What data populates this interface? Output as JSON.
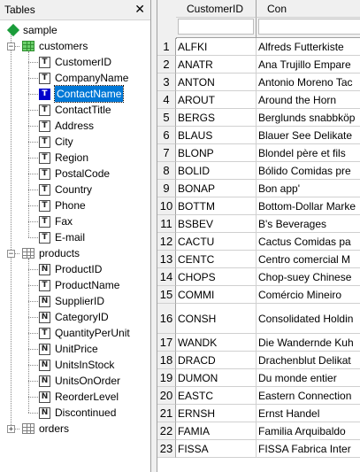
{
  "tables_pane": {
    "title": "Tables",
    "close_label": "✕",
    "database": "sample",
    "tables": [
      {
        "name": "customers",
        "expanded": true,
        "active": true,
        "fields": [
          {
            "name": "CustomerID",
            "type_glyph": "T"
          },
          {
            "name": "CompanyName",
            "type_glyph": "T"
          },
          {
            "name": "ContactName",
            "type_glyph": "T",
            "selected": true
          },
          {
            "name": "ContactTitle",
            "type_glyph": "T"
          },
          {
            "name": "Address",
            "type_glyph": "T"
          },
          {
            "name": "City",
            "type_glyph": "T"
          },
          {
            "name": "Region",
            "type_glyph": "T"
          },
          {
            "name": "PostalCode",
            "type_glyph": "T"
          },
          {
            "name": "Country",
            "type_glyph": "T"
          },
          {
            "name": "Phone",
            "type_glyph": "T"
          },
          {
            "name": "Fax",
            "type_glyph": "T"
          },
          {
            "name": "E-mail",
            "type_glyph": "T"
          }
        ]
      },
      {
        "name": "products",
        "expanded": true,
        "active": false,
        "fields": [
          {
            "name": "ProductID",
            "type_glyph": "N"
          },
          {
            "name": "ProductName",
            "type_glyph": "T"
          },
          {
            "name": "SupplierID",
            "type_glyph": "N"
          },
          {
            "name": "CategoryID",
            "type_glyph": "N"
          },
          {
            "name": "QuantityPerUnit",
            "type_glyph": "T"
          },
          {
            "name": "UnitPrice",
            "type_glyph": "N"
          },
          {
            "name": "UnitsInStock",
            "type_glyph": "N"
          },
          {
            "name": "UnitsOnOrder",
            "type_glyph": "N"
          },
          {
            "name": "ReorderLevel",
            "type_glyph": "N"
          },
          {
            "name": "Discontinued",
            "type_glyph": "N"
          }
        ]
      },
      {
        "name": "orders",
        "expanded": false,
        "active": false,
        "fields": []
      }
    ]
  },
  "grid": {
    "columns": [
      "CustomerID",
      "Con"
    ],
    "rows": [
      {
        "num": "1",
        "id": "ALFKI",
        "name": "Alfreds Futterkiste"
      },
      {
        "num": "2",
        "id": "ANATR",
        "name": "Ana Trujillo Empare"
      },
      {
        "num": "3",
        "id": "ANTON",
        "name": "Antonio Moreno Tac"
      },
      {
        "num": "4",
        "id": "AROUT",
        "name": "Around the Horn"
      },
      {
        "num": "5",
        "id": "BERGS",
        "name": "Berglunds snabbköp"
      },
      {
        "num": "6",
        "id": "BLAUS",
        "name": "Blauer See Delikate"
      },
      {
        "num": "7",
        "id": "BLONP",
        "name": "Blondel père et fils"
      },
      {
        "num": "8",
        "id": "BOLID",
        "name": "Bólido Comidas pre"
      },
      {
        "num": "9",
        "id": "BONAP",
        "name": "Bon app'"
      },
      {
        "num": "10",
        "id": "BOTTM",
        "name": "Bottom-Dollar Marke"
      },
      {
        "num": "11",
        "id": "BSBEV",
        "name": "B's Beverages"
      },
      {
        "num": "12",
        "id": "CACTU",
        "name": "Cactus Comidas pa"
      },
      {
        "num": "13",
        "id": "CENTC",
        "name": "Centro comercial M"
      },
      {
        "num": "14",
        "id": "CHOPS",
        "name": "Chop-suey Chinese"
      },
      {
        "num": "15",
        "id": "COMMI",
        "name": "Comércio Mineiro"
      },
      {
        "num": "16",
        "id": "CONSH",
        "name": "Consolidated Holdin",
        "tall": true
      },
      {
        "num": "17",
        "id": "WANDK",
        "name": "Die Wandernde Kuh"
      },
      {
        "num": "18",
        "id": "DRACD",
        "name": "Drachenblut Delikat"
      },
      {
        "num": "19",
        "id": "DUMON",
        "name": "Du monde entier"
      },
      {
        "num": "20",
        "id": "EASTC",
        "name": "Eastern Connection"
      },
      {
        "num": "21",
        "id": "ERNSH",
        "name": "Ernst Handel"
      },
      {
        "num": "22",
        "id": "FAMIA",
        "name": "Familia Arquibaldo"
      },
      {
        "num": "23",
        "id": "FISSA",
        "name": "FISSA Fabrica Inter"
      }
    ]
  }
}
